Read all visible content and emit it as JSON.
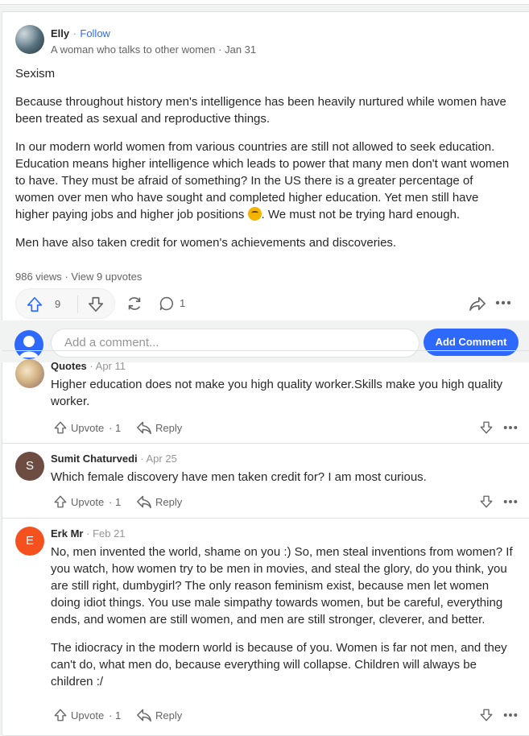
{
  "post": {
    "author": "Elly",
    "follow_label": "Follow",
    "credential": "A woman who talks to other women",
    "date": "Jan 31",
    "paragraphs": [
      "Sexism",
      "Because throughout history men's intelligence has been heavily nurtured while women have been treated as sexual and reproductive things.",
      "In our modern world women from various countries are still not allowed to seek education. Education means higher intelligence which leads to power that many men don't want women to have. They must be afraid of something? In the US there is a greater percentage of women over men who have sought and completed higher education. Yet men still have higher paying jobs and higher job positions",
      ". We must not be trying hard enough.",
      "Men have also taken credit for women's achievements and discoveries."
    ],
    "views": "986 views",
    "upvotes_link": "View 9 upvotes",
    "upvote_count": "9",
    "comment_count": "1"
  },
  "comment_box": {
    "placeholder": "Add a comment...",
    "button_label": "Add Comment"
  },
  "comments": [
    {
      "author": "Quotes",
      "date": "Apr 11",
      "avatar_color": "#d6c7a8",
      "paragraphs": [
        "Higher education does not make you high quality worker.Skills make you high quality worker."
      ],
      "upvote_label": "Upvote",
      "upvotes": "1",
      "reply_label": "Reply"
    },
    {
      "author": "Sumit Chaturvedi",
      "date": "Apr 25",
      "avatar_letter": "S",
      "avatar_color": "#6d4c41",
      "paragraphs": [
        "Which female discovery have men taken credit for? I am most curious."
      ],
      "upvote_label": "Upvote",
      "upvotes": "1",
      "reply_label": "Reply"
    },
    {
      "author": "Erk Mr",
      "date": "Feb 21",
      "avatar_letter": "E",
      "avatar_color": "#f4511e",
      "paragraphs": [
        "No, men invented the world, shame on you :) So, men steal inventions from women? If you watch, how women try to be men in movies, and steal the glory, do you think, you are still right, dumbygirl? The only reason feminism exist, because men let women doing idiot things. You use male simpathy towards women, but be careful, everything ends, and women are still women, and men are still stronger, cleverer, and better.",
        "The idiocracy in the modern world is because of you. Women is far not men, and they can't do, what men do, because everything will collapse. Children will always be children :/"
      ],
      "upvote_label": "Upvote",
      "upvotes": "1",
      "reply_label": "Reply"
    }
  ],
  "colors": {
    "accent": "#2e69ff",
    "text": "#282829",
    "muted": "#636466"
  }
}
